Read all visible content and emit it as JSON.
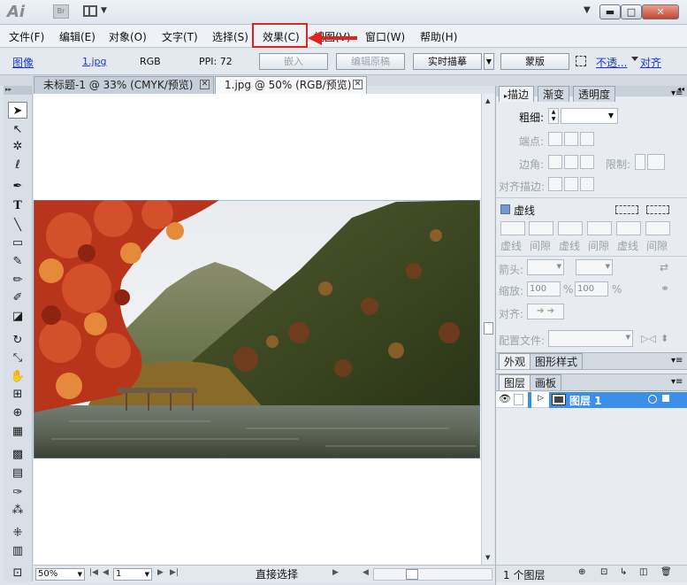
{
  "window": {
    "app_logo": "Ai",
    "bridge_label": "Br",
    "min_label": "▬",
    "max_label": "□",
    "close_label": "✕"
  },
  "menu": {
    "items": [
      "文件(F)",
      "编辑(E)",
      "对象(O)",
      "文字(T)",
      "选择(S)",
      "效果(C)",
      "视图(V)",
      "窗口(W)",
      "帮助(H)"
    ],
    "highlighted": "效果(C)"
  },
  "control_bar": {
    "type_label": "图像",
    "file_link": "1.jpg",
    "color_mode": "RGB",
    "ppi": "PPI: 72",
    "embed_button": "嵌入",
    "edit_original_button": "编辑原稿",
    "live_trace_button": "实时描摹",
    "mask_button": "蒙版",
    "opacity_link": "不透...",
    "align_link": "对齐"
  },
  "documents": {
    "tabs": [
      {
        "label": "未标题-1 @ 33% (CMYK/预览)"
      },
      {
        "label": "1.jpg @ 50% (RGB/预览)"
      }
    ]
  },
  "status_bar": {
    "zoom": "50%",
    "page": "1",
    "status_text": "直接选择"
  },
  "stroke_panel": {
    "tabs": [
      "描边",
      "渐变",
      "透明度"
    ],
    "weight_label": "粗细:",
    "cap_label": "端点:",
    "corner_label": "边角:",
    "limit_label": "限制:",
    "align_label": "对齐描边:",
    "dashed_label": "虚线",
    "dash_labels": [
      "虚线",
      "间隙",
      "虚线",
      "间隙",
      "虚线",
      "间隙"
    ],
    "arrow_label": "箭头:",
    "scale_label": "缩放:",
    "scale_value_1": "100",
    "scale_value_2": "100",
    "pct": "%",
    "arrow_align_label": "对齐:",
    "profile_label": "配置文件:"
  },
  "appearance_panel": {
    "tabs": [
      "外观",
      "图形样式"
    ]
  },
  "layers_panel": {
    "tabs": [
      "图层",
      "画板"
    ],
    "layer_name": "图层 1",
    "footer_count": "1 个图层"
  },
  "colors": {
    "layer_highlight": "#3c8fe8",
    "link_blue": "#1b38d8",
    "annotation_red": "#e0241f"
  }
}
